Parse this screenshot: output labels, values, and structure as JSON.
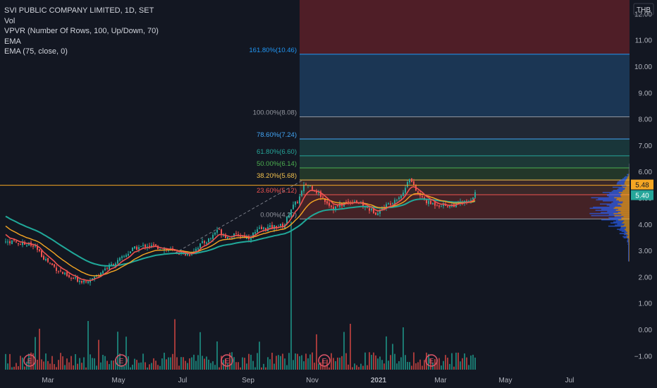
{
  "legend": {
    "symbol": "SVI PUBLIC COMPANY LIMITED, 1D, SET",
    "vol": "Vol",
    "vpvr": "VPVR (Number Of Rows, 100, Up/Down, 70)",
    "ema1": "EMA",
    "ema2": "EMA (75, close, 0)"
  },
  "currency": "THB",
  "colors": {
    "background": "#131722",
    "up": "#26a69a",
    "down": "#ef5350",
    "ema_fast": "#ef5350",
    "ema_mid": "#f5a623",
    "ema_slow": "#20a99a",
    "volume_up": "#1b7a72",
    "volume_down": "#a33a3a",
    "vpvr_up": "#2962ff",
    "vpvr_down": "#f5a623",
    "price_line": "#f5a623",
    "last_price_label": "#f5a623",
    "ema_label": "#26a69a"
  },
  "chart_data": {
    "type": "candlestick",
    "y_axis": {
      "ticks": [
        12,
        11,
        10,
        9,
        8,
        7,
        6,
        5,
        4,
        3,
        2,
        1,
        0,
        -1
      ],
      "tick_labels": [
        "12.00",
        "11.00",
        "10.00",
        "9.00",
        "8.00",
        "7.00",
        "6.00",
        "5.00",
        "4.00",
        "3.00",
        "2.00",
        "1.00",
        "0.00",
        "−1.00"
      ],
      "range": [
        -1.6,
        12.3
      ]
    },
    "x_axis": {
      "tick_labels": [
        "Mar",
        "May",
        "Jul",
        "Sep",
        "Nov",
        "2021",
        "Mar",
        "May",
        "Jul"
      ],
      "bold": [
        "2021"
      ]
    },
    "last_price": 5.48,
    "last_price_label": "5.48",
    "ema_label": "5.40",
    "fibonacci": [
      {
        "label": "0.00%(4.20)",
        "price": 4.2,
        "color": "#9598a1"
      },
      {
        "label": "23.60%(5.12)",
        "price": 5.12,
        "color": "#ef5350"
      },
      {
        "label": "38.20%(5.68)",
        "price": 5.68,
        "color": "#f2c14e"
      },
      {
        "label": "50.00%(6.14)",
        "price": 6.14,
        "color": "#4caf50"
      },
      {
        "label": "61.80%(6.60)",
        "price": 6.6,
        "color": "#26a69a"
      },
      {
        "label": "78.60%(7.24)",
        "price": 7.24,
        "color": "#42a5f5"
      },
      {
        "label": "100.00%(8.08)",
        "price": 8.08,
        "color": "#9598a1"
      },
      {
        "label": "161.80%(10.46)",
        "price": 10.46,
        "color": "#2196f3"
      }
    ],
    "earnings_markers": [
      "E",
      "E",
      "E",
      "E",
      "E"
    ],
    "price_path": [
      {
        "t": 0,
        "p": 3.35
      },
      {
        "t": 20,
        "p": 3.3
      },
      {
        "t": 40,
        "p": 3.15
      },
      {
        "t": 55,
        "p": 2.7
      },
      {
        "t": 70,
        "p": 2.35
      },
      {
        "t": 90,
        "p": 1.95
      },
      {
        "t": 110,
        "p": 1.85
      },
      {
        "t": 125,
        "p": 1.95
      },
      {
        "t": 140,
        "p": 2.3
      },
      {
        "t": 160,
        "p": 2.6
      },
      {
        "t": 180,
        "p": 3.05
      },
      {
        "t": 200,
        "p": 3.2
      },
      {
        "t": 220,
        "p": 3.1
      },
      {
        "t": 240,
        "p": 2.95
      },
      {
        "t": 260,
        "p": 2.85
      },
      {
        "t": 275,
        "p": 3.2
      },
      {
        "t": 290,
        "p": 3.45
      },
      {
        "t": 300,
        "p": 3.8
      },
      {
        "t": 315,
        "p": 3.5
      },
      {
        "t": 330,
        "p": 3.6
      },
      {
        "t": 345,
        "p": 3.5
      },
      {
        "t": 360,
        "p": 3.8
      },
      {
        "t": 380,
        "p": 3.9
      },
      {
        "t": 395,
        "p": 3.95
      },
      {
        "t": 405,
        "p": 4.6
      },
      {
        "t": 415,
        "p": 4.9
      },
      {
        "t": 425,
        "p": 5.55
      },
      {
        "t": 435,
        "p": 5.4
      },
      {
        "t": 450,
        "p": 5.0
      },
      {
        "t": 465,
        "p": 4.6
      },
      {
        "t": 480,
        "p": 4.8
      },
      {
        "t": 495,
        "p": 4.9
      },
      {
        "t": 510,
        "p": 4.65
      },
      {
        "t": 525,
        "p": 4.45
      },
      {
        "t": 540,
        "p": 4.7
      },
      {
        "t": 555,
        "p": 5.0
      },
      {
        "t": 565,
        "p": 5.2
      },
      {
        "t": 572,
        "p": 5.85
      },
      {
        "t": 580,
        "p": 5.35
      },
      {
        "t": 590,
        "p": 5.0
      },
      {
        "t": 600,
        "p": 4.8
      },
      {
        "t": 615,
        "p": 4.75
      },
      {
        "t": 630,
        "p": 4.7
      },
      {
        "t": 645,
        "p": 4.8
      },
      {
        "t": 660,
        "p": 4.85
      },
      {
        "t": 668,
        "p": 5.45
      }
    ]
  }
}
